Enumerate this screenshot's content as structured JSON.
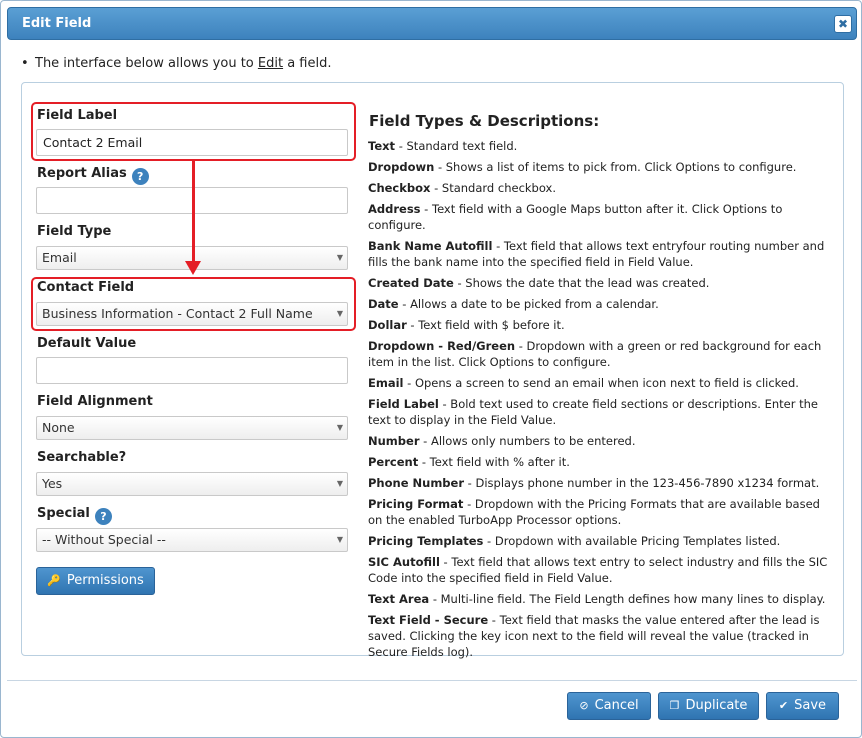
{
  "dialog": {
    "title": "Edit Field",
    "close_glyph": "✖"
  },
  "intro": {
    "bullet": "•",
    "before": "The interface below allows you to ",
    "link": "Edit",
    "after": " a field."
  },
  "form": {
    "field_label": {
      "label": "Field Label",
      "value": "Contact 2 Email"
    },
    "report_alias": {
      "label": "Report Alias",
      "value": "",
      "help": "?"
    },
    "field_type": {
      "label": "Field Type",
      "selected": "Email"
    },
    "contact_field": {
      "label": "Contact Field",
      "selected": "Business Information - Contact 2 Full Name"
    },
    "default_value": {
      "label": "Default Value",
      "value": ""
    },
    "field_alignment": {
      "label": "Field Alignment",
      "selected": "None"
    },
    "searchable": {
      "label": "Searchable?",
      "selected": "Yes"
    },
    "special": {
      "label": "Special",
      "selected": "-- Without Special --",
      "help": "?"
    },
    "permissions_button": "Permissions"
  },
  "field_types": {
    "title": "Field Types & Descriptions:",
    "items": [
      {
        "name": "Text",
        "desc": " - Standard text field."
      },
      {
        "name": "Dropdown",
        "desc": " - Shows a list of items to pick from. Click Options to configure."
      },
      {
        "name": "Checkbox",
        "desc": " - Standard checkbox."
      },
      {
        "name": "Address",
        "desc": " - Text field with a Google Maps button after it. Click Options to configure."
      },
      {
        "name": "Bank Name Autofill",
        "desc": " - Text field that allows text entryfour routing number and fills the bank name into the specified field in Field Value."
      },
      {
        "name": "Created Date",
        "desc": " - Shows the date that the lead was created."
      },
      {
        "name": "Date",
        "desc": " - Allows a date to be picked from a calendar."
      },
      {
        "name": "Dollar",
        "desc": " - Text field with $ before it."
      },
      {
        "name": "Dropdown - Red/Green",
        "desc": " - Dropdown with a green or red background for each item in the list. Click Options to configure."
      },
      {
        "name": "Email",
        "desc": " - Opens a screen to send an email when icon next to field is clicked."
      },
      {
        "name": "Field Label",
        "desc": " - Bold text used to create field sections or descriptions. Enter the text to display in the Field Value."
      },
      {
        "name": "Number",
        "desc": " - Allows only numbers to be entered."
      },
      {
        "name": "Percent",
        "desc": " - Text field with % after it."
      },
      {
        "name": "Phone Number",
        "desc": " - Displays phone number in the 123-456-7890 x1234 format."
      },
      {
        "name": "Pricing Format",
        "desc": " - Dropdown with the Pricing Formats that are available based on the enabled TurboApp Processor options."
      },
      {
        "name": "Pricing Templates",
        "desc": " - Dropdown with available Pricing Templates listed."
      },
      {
        "name": "SIC Autofill",
        "desc": " - Text field that allows text entry to select industry and fills the SIC Code into the specified field in Field Value."
      },
      {
        "name": "Text Area",
        "desc": " - Multi-line field. The Field Length defines how many lines to display."
      },
      {
        "name": "Text Field - Secure",
        "desc": " - Text field that masks the value entered after the lead is saved. Clicking the key icon next to the field will reveal the value (tracked in Secure Fields log)."
      }
    ]
  },
  "footer": {
    "cancel": "Cancel",
    "duplicate": "Duplicate",
    "save": "Save"
  },
  "colors": {
    "accent": "#3d82bd",
    "highlight": "#e41e26"
  }
}
